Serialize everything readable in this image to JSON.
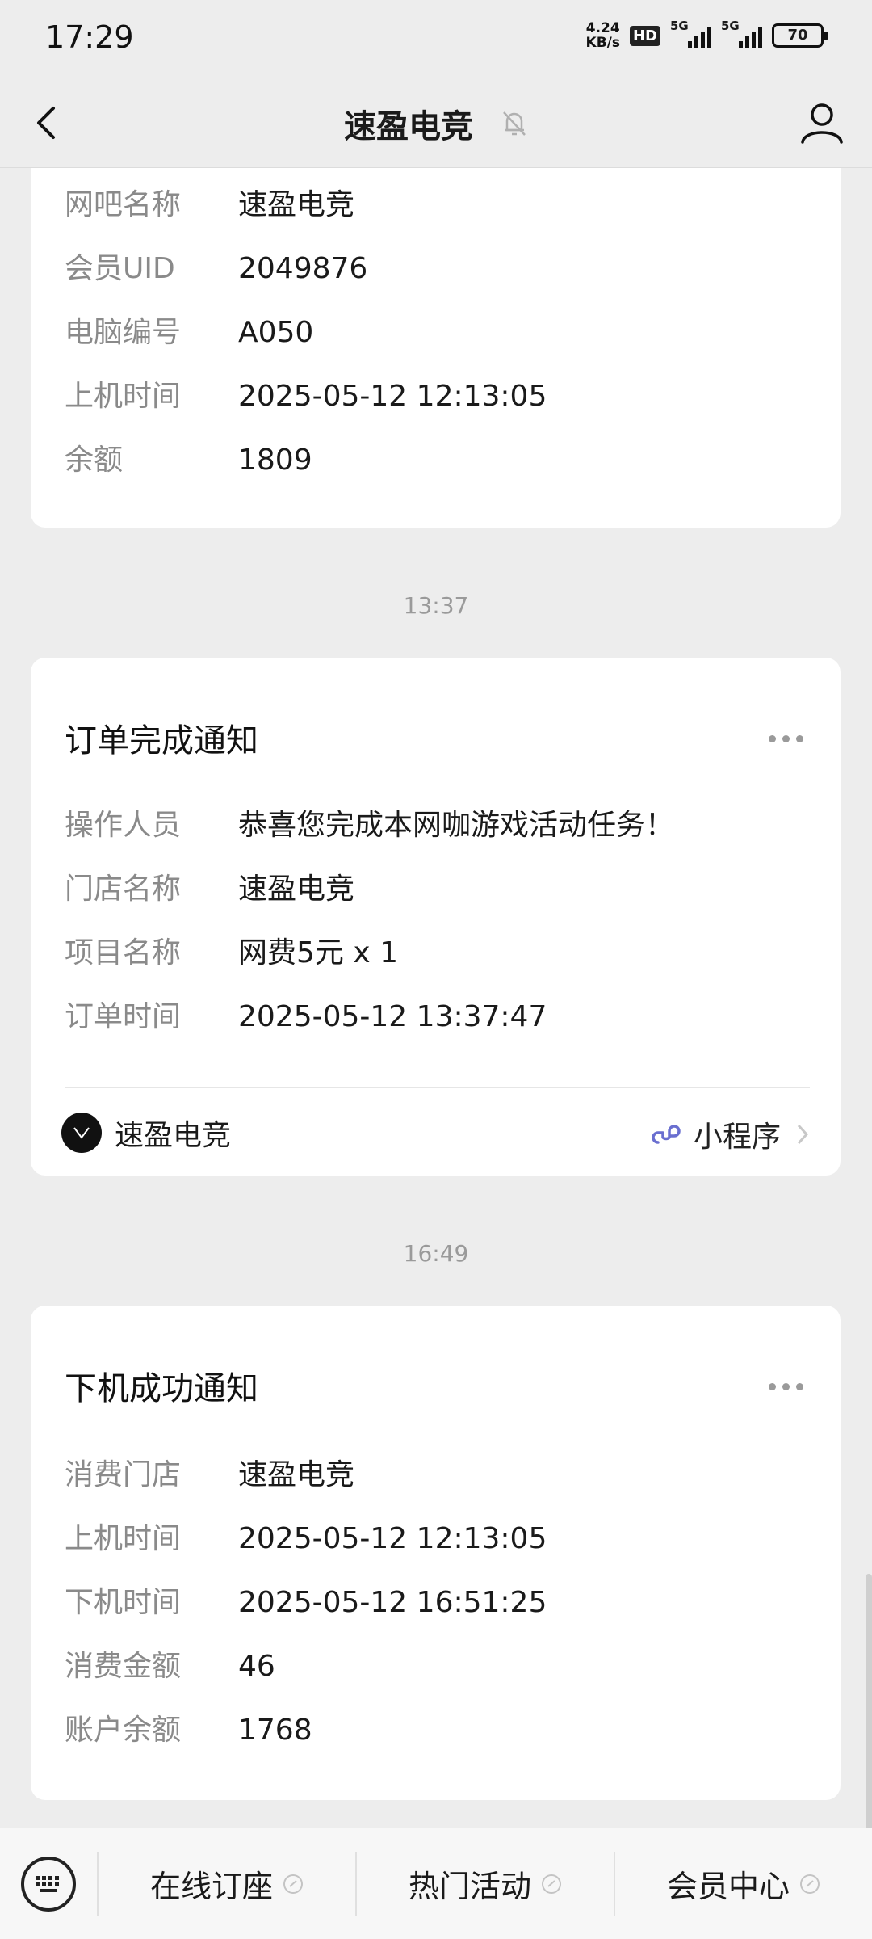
{
  "status": {
    "time": "17:29",
    "speed_top": "4.24",
    "speed_bottom": "KB/s",
    "hd": "HD",
    "signal1": "5G",
    "signal2": "5G",
    "battery": "70"
  },
  "header": {
    "title": "速盈电竞"
  },
  "card1": {
    "rows": [
      {
        "k": "网吧名称",
        "v": "速盈电竞"
      },
      {
        "k": "会员UID",
        "v": "2049876"
      },
      {
        "k": "电脑编号",
        "v": "A050"
      },
      {
        "k": "上机时间",
        "v": "2025-05-12 12:13:05"
      },
      {
        "k": "余额",
        "v": "1809"
      }
    ]
  },
  "ts1": "13:37",
  "card2": {
    "title": "订单完成通知",
    "rows": [
      {
        "k": "操作人员",
        "v": "恭喜您完成本网咖游戏活动任务！"
      },
      {
        "k": "门店名称",
        "v": "速盈电竞"
      },
      {
        "k": "项目名称",
        "v": "网费5元 x 1"
      },
      {
        "k": "订单时间",
        "v": "2025-05-12 13:37:47"
      }
    ],
    "source": "速盈电竞",
    "mini_program": "小程序"
  },
  "ts2": "16:49",
  "card3": {
    "title": "下机成功通知",
    "rows": [
      {
        "k": "消费门店",
        "v": "速盈电竞"
      },
      {
        "k": "上机时间",
        "v": "2025-05-12 12:13:05"
      },
      {
        "k": "下机时间",
        "v": "2025-05-12 16:51:25"
      },
      {
        "k": "消费金额",
        "v": "46"
      },
      {
        "k": "账户余额",
        "v": "1768"
      }
    ]
  },
  "menu": [
    {
      "label": "在线订座"
    },
    {
      "label": "热门活动"
    },
    {
      "label": "会员中心"
    }
  ]
}
